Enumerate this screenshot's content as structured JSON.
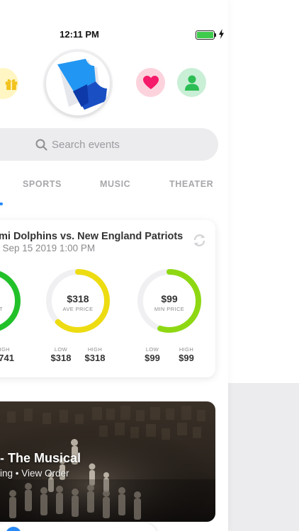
{
  "status_bar": {
    "time": "12:11 PM",
    "battery_level": 1.0
  },
  "colors": {
    "accent": "#2a8af5",
    "gift_bg": "#fff6c4",
    "heart_bg": "#fcd3dd",
    "user_bg": "#c9efd6",
    "ring_green": "#22c12a",
    "ring_yellow": "#eddc12",
    "ring_lime": "#8ed813"
  },
  "header": {
    "left_icon": "gift-icon",
    "logo": "ticket-logo",
    "right_icons": [
      "heart-icon",
      "user-icon"
    ]
  },
  "search": {
    "placeholder": "Search events",
    "value": ""
  },
  "tabs": [
    {
      "label": "SPORTS"
    },
    {
      "label": "MUSIC"
    },
    {
      "label": "THEATER"
    }
  ],
  "event_card": {
    "title": "mi Dolphins vs. New England Patriots",
    "date": ", Sep 15 2019 1:00 PM",
    "refresh_icon": "refresh-icon",
    "rings": [
      {
        "label": "FT",
        "fill": 0.85,
        "color": "#22c12a",
        "sub": [
          {
            "label": "HIGH",
            "value": "741"
          }
        ]
      },
      {
        "value": "$318",
        "label": "AVE PRICE",
        "fill": 0.62,
        "color": "#eddc12",
        "sub": [
          {
            "label": "LOW",
            "value": "$318"
          },
          {
            "label": "HIGH",
            "value": "$318"
          }
        ]
      },
      {
        "value": "$99",
        "label": "MIN PRICE",
        "fill": 0.55,
        "color": "#8ed813",
        "sub": [
          {
            "label": "LOW",
            "value": "$99"
          },
          {
            "label": "HIGH",
            "value": "$99"
          }
        ]
      }
    ]
  },
  "show_card": {
    "title": "- The Musical",
    "status": "ing",
    "separator": " • ",
    "link": "View Order"
  }
}
